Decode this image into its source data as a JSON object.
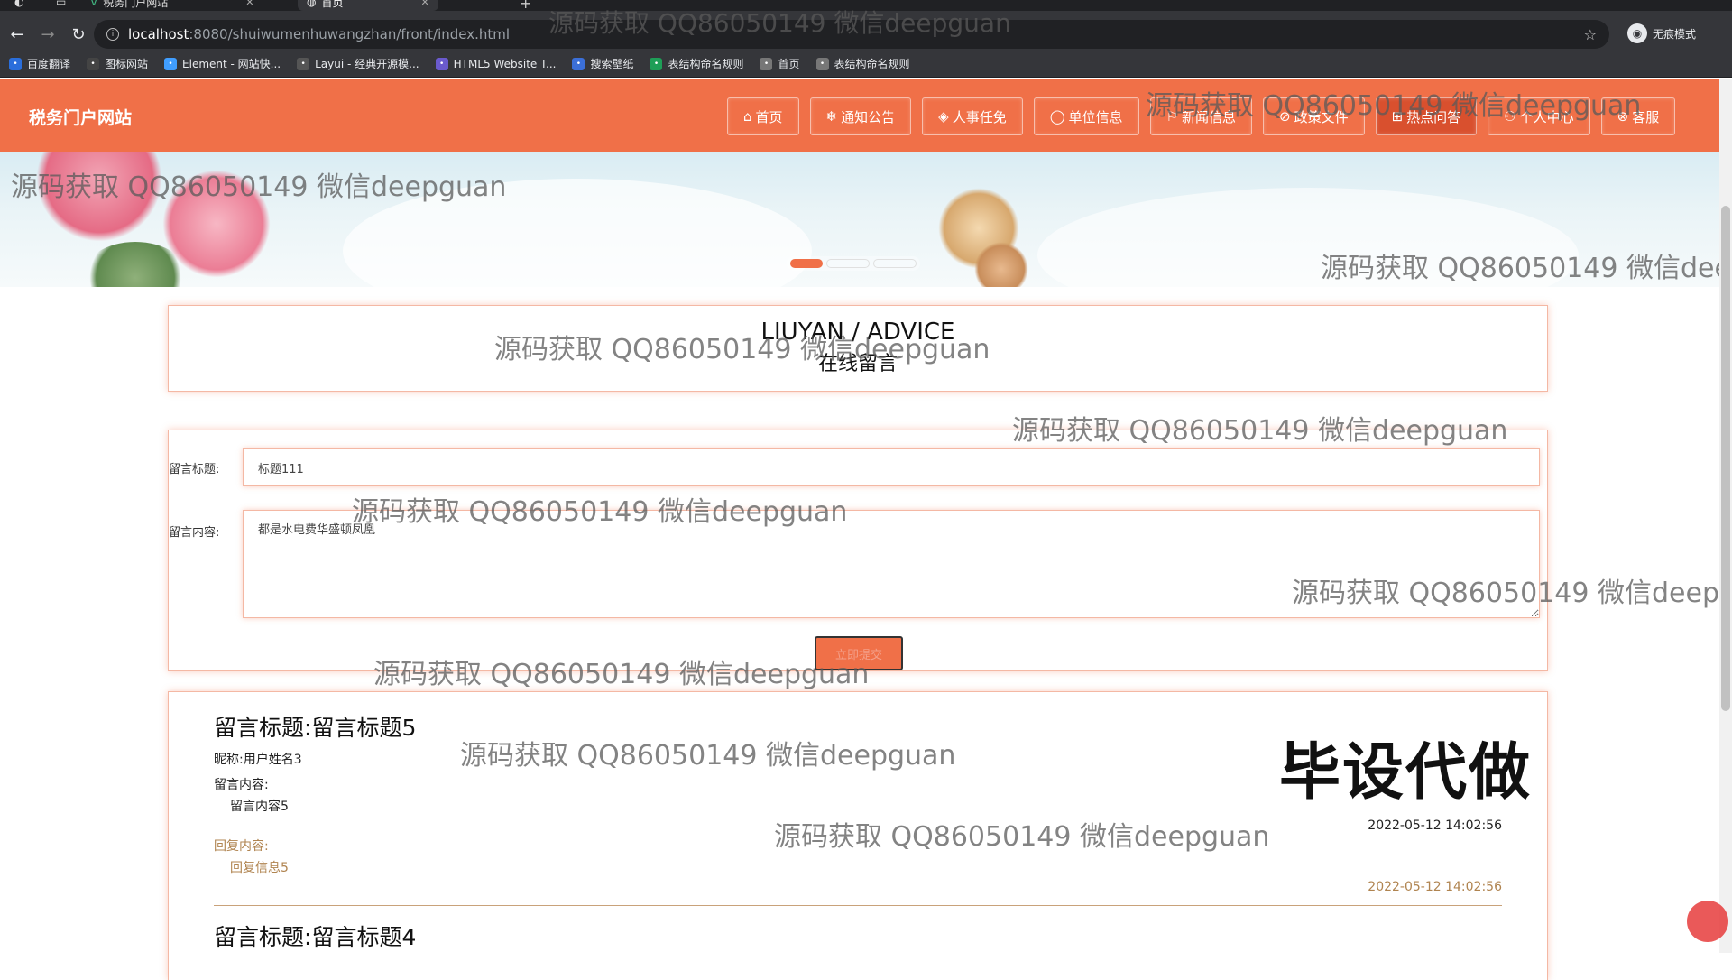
{
  "browser": {
    "tabs": [
      {
        "title": "税务门户网站"
      },
      {
        "title": "首页"
      }
    ],
    "url_host": "localhost",
    "url_path": ":8080/shuiwumenhuwangzhan/front/index.html",
    "incognito_label": "无痕模式",
    "bookmarks": [
      {
        "label": "百度翻译",
        "icon": "translate-icon",
        "color": "#2a6edb"
      },
      {
        "label": "图标网站",
        "icon": "flag-icon",
        "color": "#444"
      },
      {
        "label": "Element - 网站快...",
        "icon": "element-icon",
        "color": "#409eff"
      },
      {
        "label": "Layui - 经典开源模...",
        "icon": "layui-icon",
        "color": "#555"
      },
      {
        "label": "HTML5 Website T...",
        "icon": "html5-icon",
        "color": "#6a5acd"
      },
      {
        "label": "搜索壁纸",
        "icon": "wallpaper-icon",
        "color": "#3b6fd8"
      },
      {
        "label": "表结构命名规则",
        "icon": "sheet-icon",
        "color": "#1e9e57"
      },
      {
        "label": "首页",
        "icon": "globe-icon",
        "color": "#777"
      },
      {
        "label": "表结构命名规则",
        "icon": "globe-icon",
        "color": "#777"
      }
    ]
  },
  "site": {
    "title": "税务门户网站",
    "nav": [
      {
        "label": "首页",
        "glyph": "⌂",
        "icon": "home-icon"
      },
      {
        "label": "通知公告",
        "glyph": "❄",
        "icon": "notice-icon"
      },
      {
        "label": "人事任免",
        "glyph": "◈",
        "icon": "layers-icon"
      },
      {
        "label": "单位信息",
        "glyph": "◯",
        "icon": "unit-icon"
      },
      {
        "label": "新闻信息",
        "glyph": "⚐",
        "icon": "news-icon"
      },
      {
        "label": "政策文件",
        "glyph": "⊘",
        "icon": "policy-icon"
      },
      {
        "label": "热点问答",
        "glyph": "⊞",
        "icon": "qa-icon"
      },
      {
        "label": "个人中心",
        "glyph": "⚇",
        "icon": "user-icon"
      },
      {
        "label": "客服",
        "glyph": "⊗",
        "icon": "service-icon"
      }
    ],
    "active_nav": "热点问答"
  },
  "heading": {
    "en": "LIUYAN / ADVICE",
    "cn": "在线留言"
  },
  "form": {
    "title_label": "留言标题:",
    "title_value": "标题111",
    "content_label": "留言内容:",
    "content_value": "都是水电费华盛顿凤凰",
    "submit_label": "立即提交"
  },
  "messages": [
    {
      "title_prefix": "留言标题:",
      "title": "留言标题5",
      "nickname_line": "昵称:用户姓名3",
      "content_label": "留言内容:",
      "content": "留言内容5",
      "time": "2022-05-12 14:02:56",
      "reply_label": "回复内容:",
      "reply": "回复信息5",
      "reply_time": "2022-05-12 14:02:56"
    },
    {
      "title_prefix": "留言标题:",
      "title": "留言标题4"
    }
  ],
  "promo_text": "毕设代做",
  "watermark_text": "源码获取 QQ86050149 微信deepguan",
  "colors": {
    "accent": "#f07048",
    "accent_dark": "#d9502e",
    "reply": "#b08450"
  }
}
